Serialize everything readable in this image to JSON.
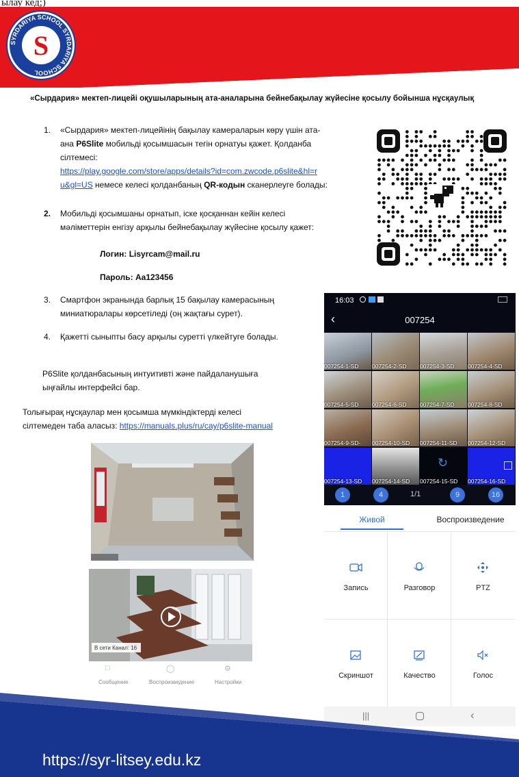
{
  "top_cut_text": "ылау кед;)",
  "logo": {
    "ring_text": "SYRDARIYA SCHOOL SYRDARIYA SCHOOL",
    "letter": "S"
  },
  "heading": "«Сырдария» мектеп-лицейі оқушыларының ата-аналарына бейнебақылау жүйесіне қосылу бойынша нұсқаулық",
  "steps": {
    "s1": {
      "num": "1.",
      "line1": "«Сырдария» мектеп-лицейінің бақылау камераларын көру үшін ата-",
      "line2_a": "ана ",
      "line2_b": "P6Slite",
      "line2_c": " мобильді қосымшасын тегін орнатуы қажет. Қолданба",
      "line3": "сілтемесі:",
      "link_a": "https://play.google.com/store/apps/details?id=com.zwcode.p6slite&hl=r",
      "link_b": "u&gl=US",
      "line5_a": " немесе келесі қолданбаның ",
      "line5_b": "QR-кодын",
      "line5_c": " сканерлеуге болады:"
    },
    "s2": {
      "num": "2.",
      "line1": "Мобильді қосымшаны орнатып, іске қосқаннан кейін келесі",
      "line2": "мәліметтерін енгізу арқылы бейнебақылау жүйесіне қосылу қажет:"
    },
    "login": "Логин: Lisyrcam@mail.ru",
    "password": "Пароль: Aa123456",
    "s3": {
      "num": "3.",
      "line1": " Смартфон экранында барлық 15 бақылау камерасының",
      "line2": "миниатюралары көрсетіледі (оң жақтағы сурет)."
    },
    "s4": {
      "num": "4.",
      "line1": "Қажетті сыныпты басу арқылы суретті үлкейтуге болады."
    }
  },
  "intuitive": {
    "line1": "P6Slite қолданбасының интуитивті және пайдаланушыға",
    "line2": "ыңғайлы интерфейсі бар."
  },
  "more": {
    "line1": "Толығырақ нұсқаулар мен қосымша мүмкіндіктерді келесі",
    "line2_a": "сілтемеден таба аласыз: ",
    "link": "https://manuals.plus/ru/cay/p6slite-manual"
  },
  "phone": {
    "time": "16:03",
    "title": "007254",
    "cells": [
      "007254-1-SD",
      "007254-2-SD",
      "007254-3-SD",
      "007254-4-SD",
      "007254-5-SD",
      "007254-6-SD",
      "007254-7-SD",
      "007254-8-SD",
      "007254-9-SD-",
      "007254-10-SD",
      "007254-11-SD",
      "007254-12-SD",
      "007254-13-SD",
      "007254-14-SD",
      "007254-15-SD",
      "007254-16-SD"
    ],
    "pager": {
      "p1": "1",
      "p4": "4",
      "page": "1/1",
      "p9": "9",
      "p16": "16"
    },
    "tab_live": "Живой",
    "tab_playback": "Воспроизведение",
    "actions": [
      "Запись",
      "Разговор",
      "PTZ",
      "Скриншот",
      "Качество",
      "Голос"
    ],
    "accent": "#2f6fd8"
  },
  "cam2": {
    "status": "В сети  Канал: 16"
  },
  "cam_tabs": {
    "message": "Сообщение",
    "playback": "Воспроизведение",
    "settings": "Настройки"
  },
  "footer_url": "https://syr-litsey.edu.kz",
  "colors": {
    "banner_red": "#e4161b",
    "footer_blue": "#17348f",
    "link_blue": "#1a4fd6"
  }
}
